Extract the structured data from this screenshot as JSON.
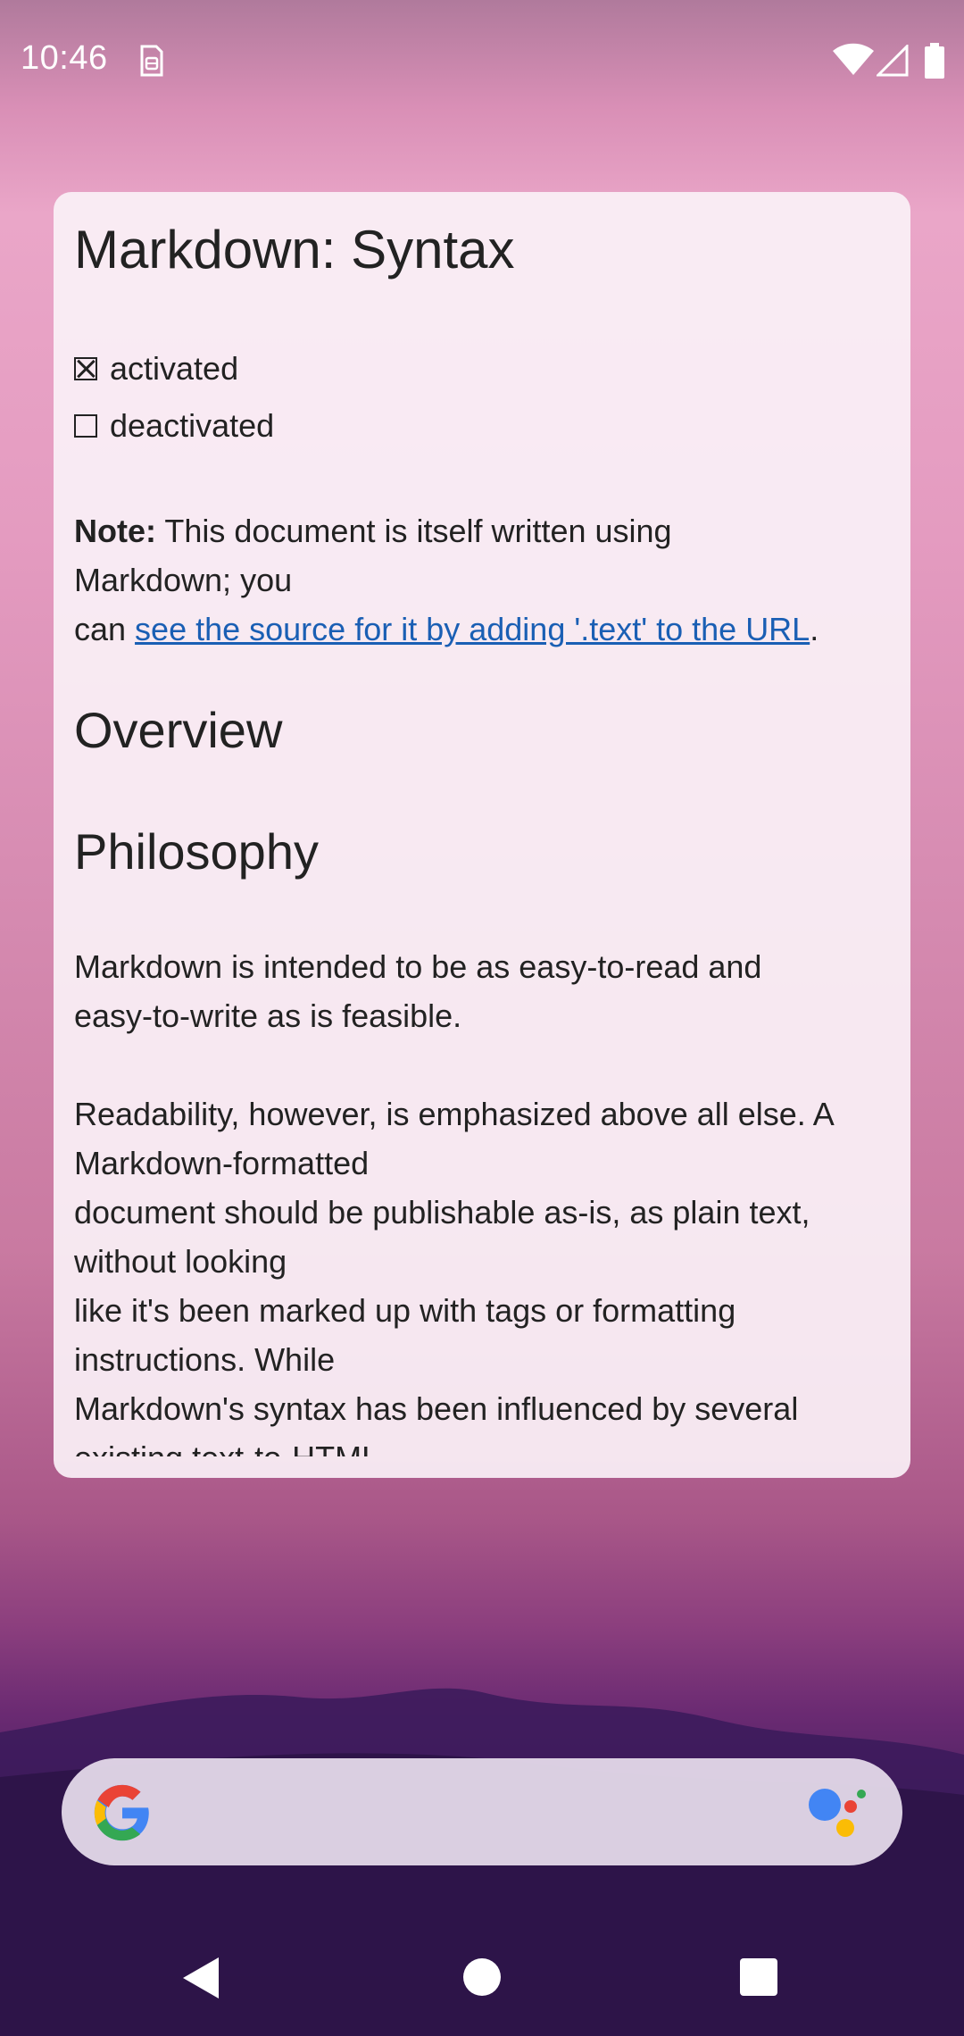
{
  "status_bar": {
    "time": "10:46",
    "notification_icon": "sim-card-icon",
    "icons": [
      "wifi-icon",
      "signal-icon",
      "battery-icon"
    ]
  },
  "widget": {
    "title": "Markdown: Syntax",
    "tasks": [
      {
        "label": "activated",
        "checked": true
      },
      {
        "label": "deactivated",
        "checked": false
      }
    ],
    "note": {
      "bold": "Note:",
      "line1": " This document is itself written using",
      "line2": "Markdown; you",
      "line3_prefix": "can ",
      "link_text": "see the source for it by adding '.text' to the URL",
      "line3_suffix": "."
    },
    "overview_heading": "Overview",
    "philosophy_heading": "Philosophy",
    "para1": [
      "Markdown is intended to be as easy-to-read and",
      "easy-to-write as is feasible."
    ],
    "para2": [
      "Readability, however, is emphasized above all else. A",
      "Markdown-formatted",
      "document should be publishable as-is, as plain text,",
      "without looking",
      "like it's been marked up with tags or formatting",
      "instructions. While",
      "Markdown's syntax has been influenced by several",
      "existing text-to-HTML"
    ]
  },
  "search_bar": {
    "left_icon": "google-g-icon",
    "right_icon": "google-assistant-icon"
  },
  "nav_bar": {
    "buttons": [
      "back-button",
      "home-button",
      "recents-button"
    ]
  },
  "colors": {
    "link": "#1a5fb4",
    "card_bg": "#faf0f6",
    "google_blue": "#4285F4",
    "google_red": "#EA4335",
    "google_yellow": "#FBBC05",
    "google_green": "#34A853"
  }
}
